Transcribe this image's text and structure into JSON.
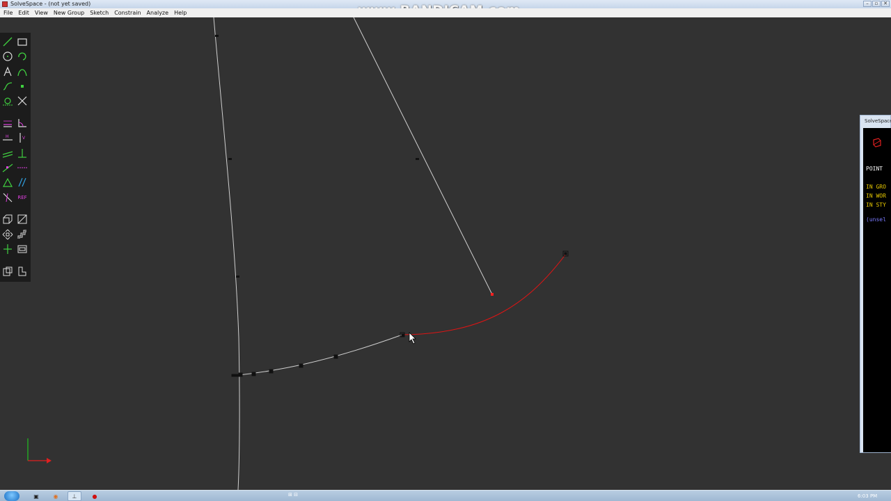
{
  "window": {
    "title": "SolveSpace - (not yet saved)",
    "controls": [
      "–",
      "▫",
      "✕"
    ]
  },
  "watermark": "www.BANDICAM.com",
  "menu": [
    "File",
    "Edit",
    "View",
    "New Group",
    "Sketch",
    "Constrain",
    "Analyze",
    "Help"
  ],
  "toolbar": {
    "ref_label": "REF",
    "tools": [
      "line-icon",
      "rectangle-icon",
      "circle-icon",
      "arc-icon",
      "text-icon",
      "tangent-arc-icon",
      "bezier-icon",
      "point-icon",
      "construction-icon",
      "split-icon",
      "distance-icon",
      "angle-icon",
      "horizontal-icon",
      "vertical-icon",
      "parallel-icon",
      "perpendicular-icon",
      "point-on-icon",
      "symmetric-icon",
      "equal-icon",
      "other-angle-icon",
      "nearest-ortho-icon",
      "ref-icon",
      "extrude-icon",
      "workplane-icon",
      "step-translate-icon",
      "step-rotate-icon",
      "lathe-icon",
      "import-icon",
      "assemble-icon",
      "sketch-in-3d-icon"
    ]
  },
  "property_browser": {
    "title": "SolveSpace",
    "lines": [
      {
        "text": "POINT",
        "color": "#ffffff"
      },
      {
        "text": "IN GRO",
        "color": "#e6c800"
      },
      {
        "text": "IN WOR",
        "color": "#e6c800"
      },
      {
        "text": "IN STY",
        "color": "#e6c800"
      },
      {
        "text": "(unsel",
        "color": "#7b7bff"
      }
    ]
  },
  "colors": {
    "canvas_bg": "#323232",
    "sketch_line": "#d0d0d0",
    "selected_curve": "#e01414",
    "axis_x": "#e02020",
    "axis_y": "#20c020"
  },
  "taskbar": {
    "clock": "6:03 PM",
    "tray": "⊞ ⊟"
  }
}
